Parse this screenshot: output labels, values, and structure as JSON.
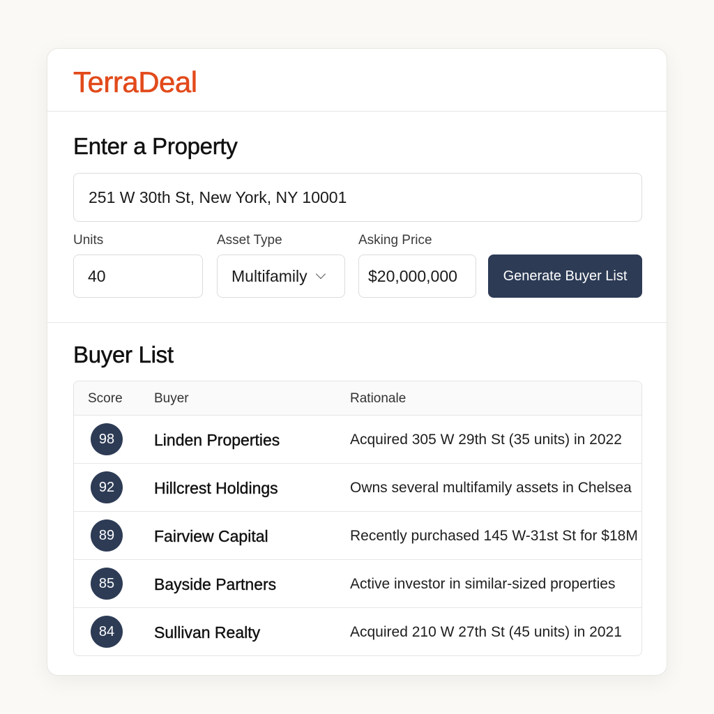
{
  "brand": {
    "name": "TerraDeal",
    "color": "#e24a1b"
  },
  "property_form": {
    "title": "Enter a Property",
    "address_value": "251 W 30th St, New York, NY 10001",
    "units": {
      "label": "Units",
      "value": "40"
    },
    "asset_type": {
      "label": "Asset Type",
      "selected": "Multifamily"
    },
    "asking_price": {
      "label": "Asking Price",
      "value": "$20,000,000"
    },
    "generate_button_label": "Generate Buyer List",
    "button_color": "#2d3b55"
  },
  "buyer_list": {
    "title": "Buyer List",
    "columns": [
      "Score",
      "Buyer",
      "Rationale"
    ],
    "rows": [
      {
        "score": "98",
        "buyer": "Linden Properties",
        "rationale": "Acquired 305 W 29th St (35 units) in 2022"
      },
      {
        "score": "92",
        "buyer": "Hillcrest Holdings",
        "rationale": "Owns several multifamily assets in Chelsea"
      },
      {
        "score": "89",
        "buyer": "Fairview Capital",
        "rationale": "Recently purchased 145 W-31st St for $18M"
      },
      {
        "score": "85",
        "buyer": "Bayside Partners",
        "rationale": "Active investor in similar-sized properties"
      },
      {
        "score": "84",
        "buyer": "Sullivan Realty",
        "rationale": "Acquired 210 W 27th St (45 units) in 2021"
      }
    ]
  }
}
